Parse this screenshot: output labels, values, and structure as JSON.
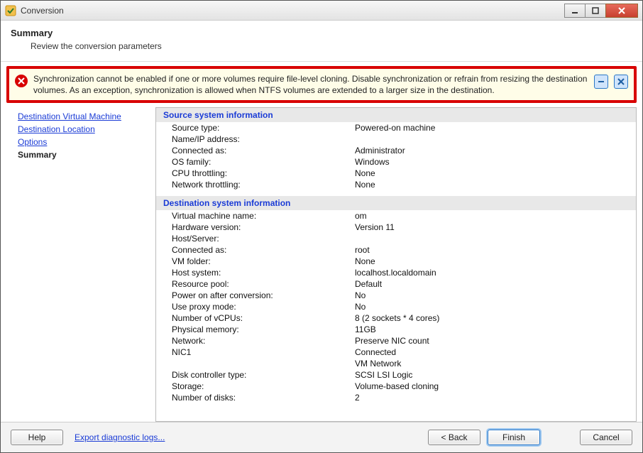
{
  "window": {
    "title": "Conversion"
  },
  "header": {
    "title": "Summary",
    "subtitle": "Review the conversion parameters"
  },
  "error": {
    "message": "Synchronization cannot be enabled if one or more volumes require file-level cloning. Disable synchronization or refrain from resizing the destination volumes. As an exception, synchronization is allowed when NTFS volumes are extended to a larger size in the destination."
  },
  "sidebar": {
    "items": [
      {
        "label": "Destination Virtual Machine",
        "current": false
      },
      {
        "label": "Destination Location",
        "current": false
      },
      {
        "label": "Options",
        "current": false
      },
      {
        "label": "Summary",
        "current": true
      }
    ]
  },
  "summary": {
    "sections": [
      {
        "heading": "Source system information",
        "rows": [
          {
            "label": "Source type:",
            "value": "Powered-on machine"
          },
          {
            "label": "Name/IP address:",
            "value": ""
          },
          {
            "label": "Connected as:",
            "value": "Administrator"
          },
          {
            "label": "OS family:",
            "value": "Windows"
          },
          {
            "label": "CPU throttling:",
            "value": "None"
          },
          {
            "label": "Network throttling:",
            "value": "None"
          }
        ]
      },
      {
        "heading": "Destination system information",
        "rows": [
          {
            "label": "Virtual machine name:",
            "value": "om"
          },
          {
            "label": "Hardware version:",
            "value": "Version 11"
          },
          {
            "label": "Host/Server:",
            "value": ""
          },
          {
            "label": "Connected as:",
            "value": "root"
          },
          {
            "label": "VM folder:",
            "value": "None"
          },
          {
            "label": "Host system:",
            "value": "localhost.localdomain"
          },
          {
            "label": "Resource pool:",
            "value": "Default"
          },
          {
            "label": "Power on after conversion:",
            "value": "No"
          },
          {
            "label": "Use proxy mode:",
            "value": "No"
          },
          {
            "label": "Number of vCPUs:",
            "value": "8 (2 sockets * 4 cores)"
          },
          {
            "label": "Physical memory:",
            "value": "11GB"
          },
          {
            "label": "Network:",
            "value": "Preserve NIC count"
          },
          {
            "label": "NIC1",
            "value": "Connected"
          },
          {
            "label": "",
            "value": "VM Network"
          },
          {
            "label": "Disk controller type:",
            "value": "SCSI LSI Logic"
          },
          {
            "label": "Storage:",
            "value": "Volume-based cloning"
          },
          {
            "label": "Number of disks:",
            "value": "2"
          }
        ]
      }
    ]
  },
  "footer": {
    "help": "Help",
    "export": "Export diagnostic logs...",
    "back": "< Back",
    "finish": "Finish",
    "cancel": "Cancel"
  }
}
